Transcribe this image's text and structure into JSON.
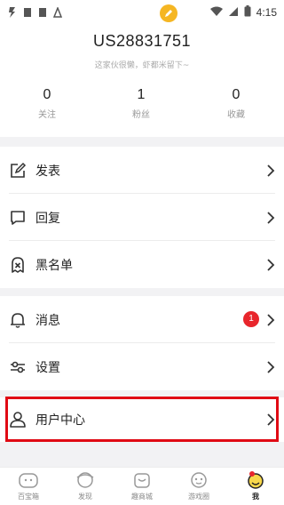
{
  "status_bar": {
    "time": "4:15"
  },
  "profile": {
    "username": "US28831751",
    "bio": "这家伙很懒，虾都米留下~"
  },
  "stats": [
    {
      "value": "0",
      "label": "关注"
    },
    {
      "value": "1",
      "label": "粉丝"
    },
    {
      "value": "0",
      "label": "收藏"
    }
  ],
  "menu_group_1": [
    {
      "label": "发表",
      "icon": "edit-icon"
    },
    {
      "label": "回复",
      "icon": "reply-icon"
    },
    {
      "label": "黑名单",
      "icon": "blacklist-icon"
    }
  ],
  "menu_group_2": [
    {
      "label": "消息",
      "icon": "bell-icon",
      "badge": "1"
    },
    {
      "label": "设置",
      "icon": "settings-icon"
    },
    {
      "label": "用户中心",
      "icon": "user-icon"
    }
  ],
  "tabbar": [
    {
      "label": "百宝箱",
      "icon": "toolbox-icon",
      "active": false
    },
    {
      "label": "发现",
      "icon": "discover-icon",
      "active": false
    },
    {
      "label": "趣商城",
      "icon": "shop-icon",
      "active": false
    },
    {
      "label": "游戏圈",
      "icon": "game-icon",
      "active": false
    },
    {
      "label": "我",
      "icon": "me-icon",
      "active": true
    }
  ],
  "colors": {
    "badge": "#e8262c",
    "highlight_border": "#e00a14",
    "avatar": "#f8d84a",
    "section_gap": "#f2f2f4"
  }
}
